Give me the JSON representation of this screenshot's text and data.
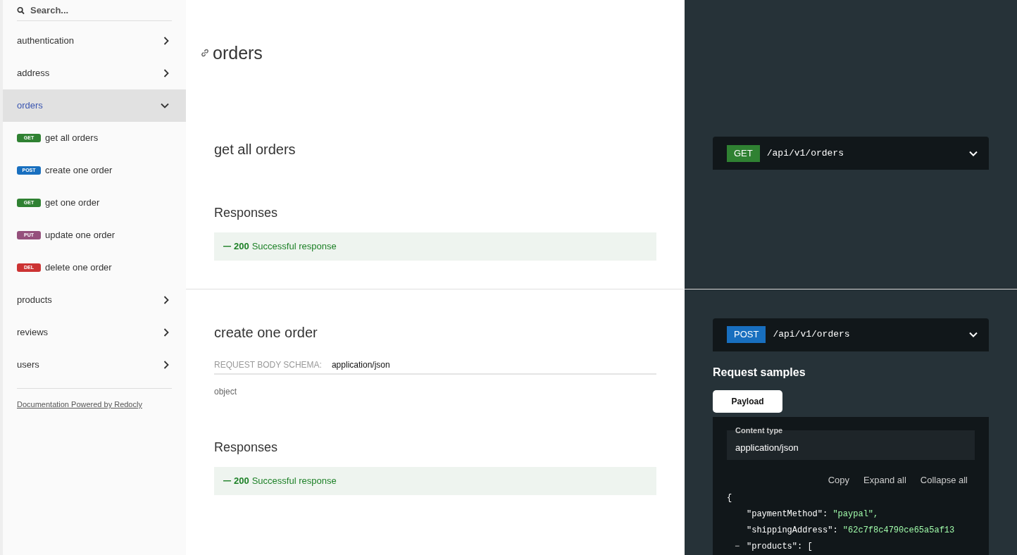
{
  "sidebar": {
    "search": {
      "placeholder": "Search..."
    },
    "items": [
      {
        "label": "authentication",
        "expanded": false,
        "selected": false
      },
      {
        "label": "address",
        "expanded": false,
        "selected": false
      },
      {
        "label": "orders",
        "expanded": true,
        "selected": true,
        "children": [
          {
            "method": "GET",
            "color": "#2f8132",
            "label": "get all orders"
          },
          {
            "method": "POST",
            "color": "#186fbf",
            "label": "create one order"
          },
          {
            "method": "GET",
            "color": "#2f8132",
            "label": "get one order"
          },
          {
            "method": "PUT",
            "color": "#95507c",
            "label": "update one order"
          },
          {
            "method": "DEL",
            "color": "#cc3333",
            "label": "delete one order"
          }
        ]
      },
      {
        "label": "products",
        "expanded": false,
        "selected": false
      },
      {
        "label": "reviews",
        "expanded": false,
        "selected": false
      },
      {
        "label": "users",
        "expanded": false,
        "selected": false
      }
    ],
    "footer_link": "Documentation Powered by Redocly"
  },
  "main": {
    "title": "orders",
    "operations": [
      {
        "title": "get all orders",
        "responses_title": "Responses",
        "responses": [
          {
            "code": "200",
            "text": "Successful response"
          }
        ],
        "sample": {
          "method": "GET",
          "color": "#2f8132",
          "path": "/api/v1/orders",
          "expanded": false
        }
      },
      {
        "title": "create one order",
        "request_body": {
          "label": "REQUEST BODY SCHEMA:",
          "value": "application/json",
          "type": "object"
        },
        "responses_title": "Responses",
        "responses": [
          {
            "code": "200",
            "text": "Successful response"
          }
        ],
        "sample": {
          "method": "POST",
          "color": "#186fbf",
          "path": "/api/v1/orders",
          "expanded": false,
          "request_samples": {
            "title": "Request samples",
            "tabs": [
              {
                "label": "Payload",
                "selected": true
              }
            ],
            "content_type_label": "Content type",
            "content_type_value": "application/json",
            "actions": [
              "Copy",
              "Expand all",
              "Collapse all"
            ],
            "code": {
              "open": "{",
              "entries": [
                {
                  "key": "\"paymentMethod\": ",
                  "value": "\"paypal\","
                },
                {
                  "key": "\"shippingAddress\": ",
                  "value": "\"62c7f8c4790ce65a5af13"
                },
                {
                  "toggle": "−",
                  "key": "\"products\": ",
                  "value": "["
                }
              ]
            }
          }
        }
      }
    ]
  }
}
